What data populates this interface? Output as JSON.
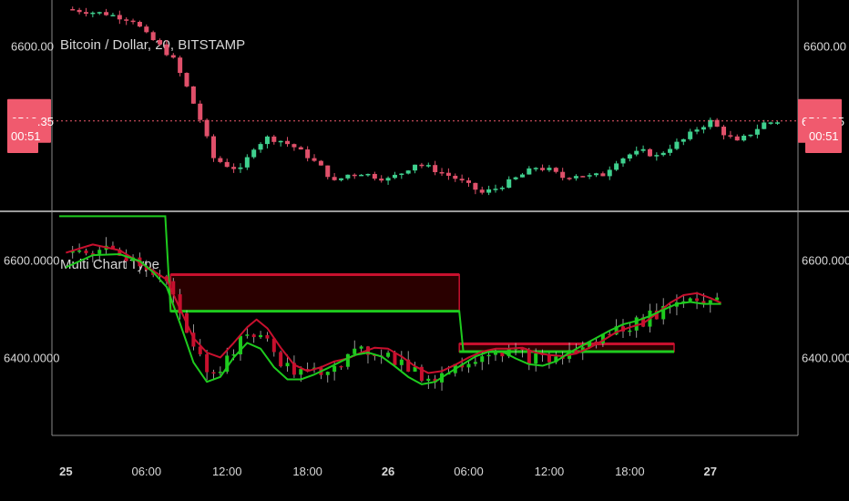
{
  "colors": {
    "background": "#000000",
    "up": "#3fd08e",
    "down": "#e0506a",
    "line_red": "#c8102e",
    "line_green": "#1ecb1e",
    "price_line": "#f05a6e",
    "frame": "#8a8a8a",
    "text": "#d8d8d8"
  },
  "chart_data": [
    {
      "type": "candlestick",
      "title": "Bitcoin / Dollar, 20, BITSTAMP",
      "ylim": [
        6430,
        6640
      ],
      "y_tick_labels": [
        "6600.00"
      ],
      "y_ticks": [
        6600
      ],
      "price_badge": "6518.35",
      "price_value": 6518.35,
      "countdown_badge": "00:51",
      "close_path": [
        [
          0,
          6640
        ],
        [
          3,
          6635
        ],
        [
          5,
          6628
        ],
        [
          6,
          6612
        ],
        [
          7,
          6600
        ],
        [
          8,
          6585
        ],
        [
          9,
          6555
        ],
        [
          10,
          6520
        ],
        [
          11,
          6478
        ],
        [
          12,
          6470
        ],
        [
          13,
          6465
        ],
        [
          14,
          6490
        ],
        [
          15,
          6500
        ],
        [
          16,
          6497
        ],
        [
          17,
          6490
        ],
        [
          18,
          6480
        ],
        [
          19,
          6468
        ],
        [
          20,
          6452
        ],
        [
          21,
          6460
        ],
        [
          22,
          6462
        ],
        [
          23,
          6458
        ],
        [
          24,
          6455
        ],
        [
          25,
          6462
        ],
        [
          26,
          6472
        ],
        [
          27,
          6468
        ],
        [
          28,
          6462
        ],
        [
          29,
          6456
        ],
        [
          30,
          6448
        ],
        [
          31,
          6440
        ],
        [
          32,
          6445
        ],
        [
          33,
          6452
        ],
        [
          34,
          6460
        ],
        [
          35,
          6468
        ],
        [
          36,
          6465
        ],
        [
          37,
          6457
        ],
        [
          38,
          6460
        ],
        [
          39,
          6458
        ],
        [
          40,
          6460
        ],
        [
          41,
          6475
        ],
        [
          42,
          6482
        ],
        [
          43,
          6485
        ],
        [
          44,
          6480
        ],
        [
          45,
          6490
        ],
        [
          46,
          6498
        ],
        [
          47,
          6510
        ],
        [
          48,
          6518
        ],
        [
          49,
          6505
        ],
        [
          50,
          6495
        ],
        [
          51,
          6505
        ],
        [
          52,
          6516
        ],
        [
          53,
          6518
        ]
      ]
    },
    {
      "type": "line",
      "title": "Multi Chart Type",
      "ylim": [
        6240,
        6700
      ],
      "y_tick_labels": [
        "6600.0000",
        "6400.0000"
      ],
      "y_ticks": [
        6600,
        6400
      ],
      "x_tick_labels": [
        "25",
        "06:00",
        "12:00",
        "18:00",
        "26",
        "06:00",
        "12:00",
        "18:00",
        "27"
      ],
      "x_ticks": [
        0,
        6,
        12,
        18,
        24,
        30,
        36,
        42,
        48
      ],
      "x_bold": [
        true,
        false,
        false,
        false,
        true,
        false,
        false,
        false,
        true
      ],
      "xlim": [
        -0.5,
        51
      ],
      "series": [
        {
          "color": "red",
          "values": [
            [
              0,
              6615
            ],
            [
              2,
              6632
            ],
            [
              4,
              6620
            ],
            [
              5.5,
              6595
            ],
            [
              6.5,
              6578
            ],
            [
              7.5,
              6560
            ],
            [
              8.5,
              6500
            ],
            [
              9.5,
              6440
            ],
            [
              10.5,
              6410
            ],
            [
              11.5,
              6400
            ],
            [
              12.5,
              6430
            ],
            [
              13.5,
              6462
            ],
            [
              14.2,
              6478
            ],
            [
              15,
              6460
            ],
            [
              16,
              6420
            ],
            [
              17,
              6385
            ],
            [
              18,
              6372
            ],
            [
              19,
              6380
            ],
            [
              20,
              6392
            ],
            [
              21,
              6398
            ],
            [
              22,
              6410
            ],
            [
              23,
              6420
            ],
            [
              24,
              6418
            ],
            [
              25,
              6402
            ],
            [
              26,
              6382
            ],
            [
              27,
              6368
            ],
            [
              28,
              6372
            ],
            [
              29,
              6385
            ],
            [
              30,
              6400
            ],
            [
              31,
              6412
            ],
            [
              32,
              6418
            ],
            [
              33,
              6418
            ],
            [
              34,
              6420
            ],
            [
              35,
              6410
            ],
            [
              36,
              6405
            ],
            [
              37,
              6403
            ],
            [
              38,
              6408
            ],
            [
              39,
              6420
            ],
            [
              40,
              6435
            ],
            [
              41,
              6452
            ],
            [
              42,
              6462
            ],
            [
              43,
              6470
            ],
            [
              44,
              6490
            ],
            [
              45,
              6512
            ],
            [
              46,
              6528
            ],
            [
              47,
              6532
            ],
            [
              48,
              6522
            ],
            [
              48.8,
              6512
            ]
          ]
        },
        {
          "color": "green",
          "values": [
            [
              0,
              6585
            ],
            [
              2,
              6610
            ],
            [
              4,
              6612
            ],
            [
              5.5,
              6598
            ],
            [
              6.5,
              6575
            ],
            [
              7.5,
              6545
            ],
            [
              8.5,
              6470
            ],
            [
              9.5,
              6390
            ],
            [
              10.5,
              6350
            ],
            [
              11.5,
              6360
            ],
            [
              12.5,
              6400
            ],
            [
              13.5,
              6430
            ],
            [
              14.5,
              6418
            ],
            [
              15.5,
              6380
            ],
            [
              16.5,
              6355
            ],
            [
              17.5,
              6355
            ],
            [
              18.5,
              6365
            ],
            [
              19.5,
              6378
            ],
            [
              20.5,
              6392
            ],
            [
              21.5,
              6405
            ],
            [
              22.5,
              6410
            ],
            [
              23.5,
              6402
            ],
            [
              24.5,
              6382
            ],
            [
              25.5,
              6360
            ],
            [
              26.5,
              6345
            ],
            [
              27.5,
              6350
            ],
            [
              28.5,
              6368
            ],
            [
              29.5,
              6385
            ],
            [
              30.5,
              6402
            ],
            [
              31.5,
              6412
            ],
            [
              32.5,
              6412
            ],
            [
              33.5,
              6398
            ],
            [
              34.5,
              6386
            ],
            [
              35.5,
              6383
            ],
            [
              36.5,
              6392
            ],
            [
              37.5,
              6410
            ],
            [
              38.5,
              6425
            ],
            [
              39.5,
              6440
            ],
            [
              40.5,
              6455
            ],
            [
              41.5,
              6468
            ],
            [
              42.5,
              6475
            ],
            [
              43.5,
              6485
            ],
            [
              44.5,
              6498
            ],
            [
              45.5,
              6510
            ],
            [
              46.5,
              6514
            ],
            [
              47.5,
              6510
            ],
            [
              48.8,
              6510
            ]
          ]
        }
      ],
      "bands": [
        {
          "x_start": 7.8,
          "x_end": 29.3,
          "upper": 6570,
          "lower": 6495
        },
        {
          "x_start": 29.3,
          "x_end": 45.3,
          "upper": 6428,
          "lower": 6412
        }
      ],
      "step_line": [
        [
          -0.5,
          6690
        ],
        [
          7.4,
          6690
        ],
        [
          7.8,
          6495
        ],
        [
          29.3,
          6495
        ],
        [
          29.6,
          6412
        ],
        [
          45.3,
          6412
        ]
      ]
    }
  ]
}
